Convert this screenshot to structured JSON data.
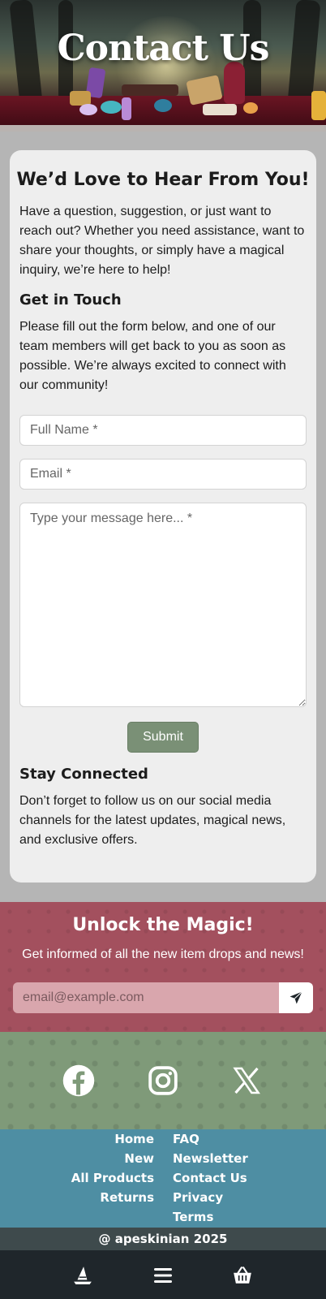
{
  "hero": {
    "title": "Contact Us"
  },
  "card": {
    "heading": "We’d Love to Hear From You!",
    "intro": "Have a question, suggestion, or just want to reach out? Whether you need assistance, want to share your thoughts, or simply have a magical inquiry, we’re here to help!",
    "get_in_touch_heading": "Get in Touch",
    "get_in_touch_text": "Please fill out the form below, and one of our team members will get back to you as soon as possible. We’re always excited to connect with our community!",
    "form": {
      "name_placeholder": "Full Name *",
      "email_placeholder": "Email *",
      "message_placeholder": "Type your message here... *",
      "submit_label": "Submit"
    },
    "stay_connected_heading": "Stay Connected",
    "stay_connected_text": "Don’t forget to follow us on our social media channels for the latest updates, magical news, and exclusive offers."
  },
  "newsletter": {
    "title": "Unlock the Magic!",
    "subtitle": "Get informed of all the new item drops and news!",
    "email_placeholder": "email@example.com",
    "send_icon": "paper-plane-icon"
  },
  "social": {
    "icons": [
      "facebook-icon",
      "instagram-icon",
      "x-icon"
    ]
  },
  "footer_links": {
    "left": [
      "Home",
      "New",
      "All Products",
      "Returns"
    ],
    "right": [
      "FAQ",
      "Newsletter",
      "Contact Us",
      "Privacy",
      "Terms"
    ]
  },
  "copyright": "@ apeskinian 2025",
  "bottom_nav": {
    "icons": [
      "witch-hat-icon",
      "menu-icon",
      "basket-icon"
    ]
  },
  "colors": {
    "page_bg": "#b5b5b5",
    "card_bg": "#eeeeee",
    "submit_bg": "#7a9076",
    "newsletter_bg": "#a3505e",
    "social_bg": "#7f9a79",
    "links_bg": "#4e8ea3",
    "copyright_bg": "#3e4a4c",
    "bottom_bar_bg": "#1f262b"
  }
}
